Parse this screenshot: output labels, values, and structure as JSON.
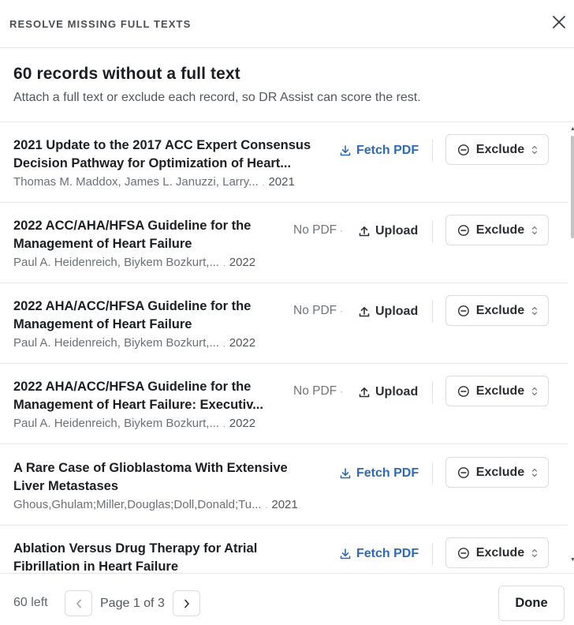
{
  "header": {
    "title": "RESOLVE MISSING FULL TEXTS",
    "close_icon": "close-icon"
  },
  "intro": {
    "title": "60 records without a full text",
    "subtitle": "Attach a full text or exclude each record, so DR Assist can score the rest."
  },
  "labels": {
    "fetch_pdf": "Fetch PDF",
    "no_pdf": "No PDF",
    "upload": "Upload",
    "exclude": "Exclude",
    "meta_sep": "."
  },
  "records": [
    {
      "title": "2021 Update to the 2017 ACC Expert Consensus Decision Pathway for Optimization of Heart...",
      "authors": "Thomas M. Maddox, James L. Januzzi, Larry...",
      "year": "2021",
      "action": "fetch"
    },
    {
      "title": "2022 ACC/AHA/HFSA Guideline for the Management of Heart Failure",
      "authors": "Paul A. Heidenreich, Biykem Bozkurt,...",
      "year": "2022",
      "action": "upload"
    },
    {
      "title": "2022 AHA/ACC/HFSA Guideline for the Management of Heart Failure",
      "authors": "Paul A. Heidenreich, Biykem Bozkurt,...",
      "year": "2022",
      "action": "upload"
    },
    {
      "title": "2022 AHA/ACC/HFSA Guideline for the Management of Heart Failure: Executiv...",
      "authors": "Paul A. Heidenreich, Biykem Bozkurt,...",
      "year": "2022",
      "action": "upload"
    },
    {
      "title": "A Rare Case of Glioblastoma With Extensive Liver Metastases",
      "authors": "Ghous,Ghulam;Miller,Douglas;Doll,Donald;Tu...",
      "year": "2021",
      "action": "fetch"
    },
    {
      "title": "Ablation Versus Drug Therapy for Atrial Fibrillation in Heart Failure",
      "authors": "",
      "year": "",
      "action": "fetch"
    }
  ],
  "footer": {
    "left_count": "60 left",
    "page_label": "Page 1 of 3",
    "done": "Done"
  },
  "colors": {
    "link_blue": "#2f6ab4",
    "border": "#dcdcdc"
  }
}
